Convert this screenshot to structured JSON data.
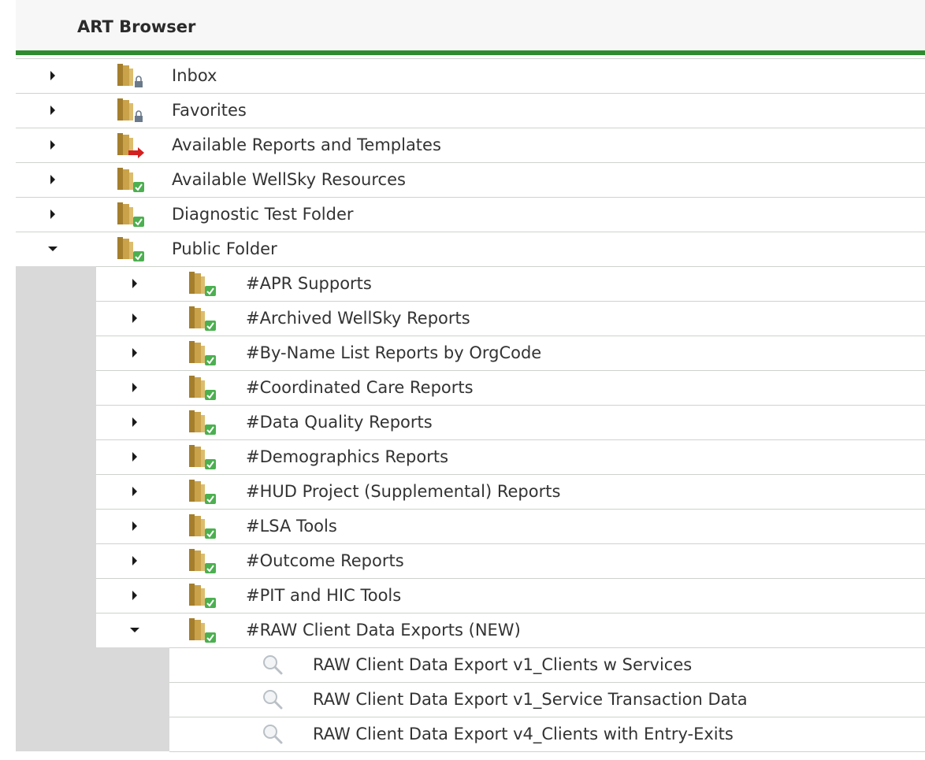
{
  "header": {
    "title": "ART Browser"
  },
  "colors": {
    "accent_rule": "#2e8b2e",
    "folder": "#c9a24a",
    "shared_badge": "#4caf50",
    "restricted_badge": "#6a7a8a",
    "link_badge": "#d42020"
  },
  "tree": {
    "top_folders": [
      {
        "label": "Inbox",
        "expanded": false,
        "badge": "lock-icon"
      },
      {
        "label": "Favorites",
        "expanded": false,
        "badge": "lock-icon"
      },
      {
        "label": "Available Reports and Templates",
        "expanded": false,
        "badge": "arrow-icon"
      },
      {
        "label": "Available WellSky Resources",
        "expanded": false,
        "badge": "check-icon"
      },
      {
        "label": "Diagnostic Test Folder",
        "expanded": false,
        "badge": "check-icon"
      },
      {
        "label": "Public Folder",
        "expanded": true,
        "badge": "check-icon"
      }
    ],
    "public_subfolders": [
      {
        "label": "#APR Supports",
        "expanded": false
      },
      {
        "label": "#Archived WellSky Reports",
        "expanded": false
      },
      {
        "label": "#By-Name List Reports by OrgCode",
        "expanded": false
      },
      {
        "label": "#Coordinated Care Reports",
        "expanded": false
      },
      {
        "label": "#Data Quality Reports",
        "expanded": false
      },
      {
        "label": "#Demographics Reports",
        "expanded": false
      },
      {
        "label": "#HUD Project (Supplemental) Reports",
        "expanded": false
      },
      {
        "label": "#LSA Tools",
        "expanded": false
      },
      {
        "label": "#Outcome Reports",
        "expanded": false
      },
      {
        "label": "#PIT and HIC Tools",
        "expanded": false
      },
      {
        "label": "#RAW Client Data Exports (NEW)",
        "expanded": true
      }
    ],
    "raw_reports": [
      {
        "label": "RAW Client Data Export v1_Clients w Services"
      },
      {
        "label": "RAW Client Data Export v1_Service Transaction Data"
      },
      {
        "label": "RAW Client Data Export v4_Clients with Entry-Exits"
      }
    ]
  }
}
